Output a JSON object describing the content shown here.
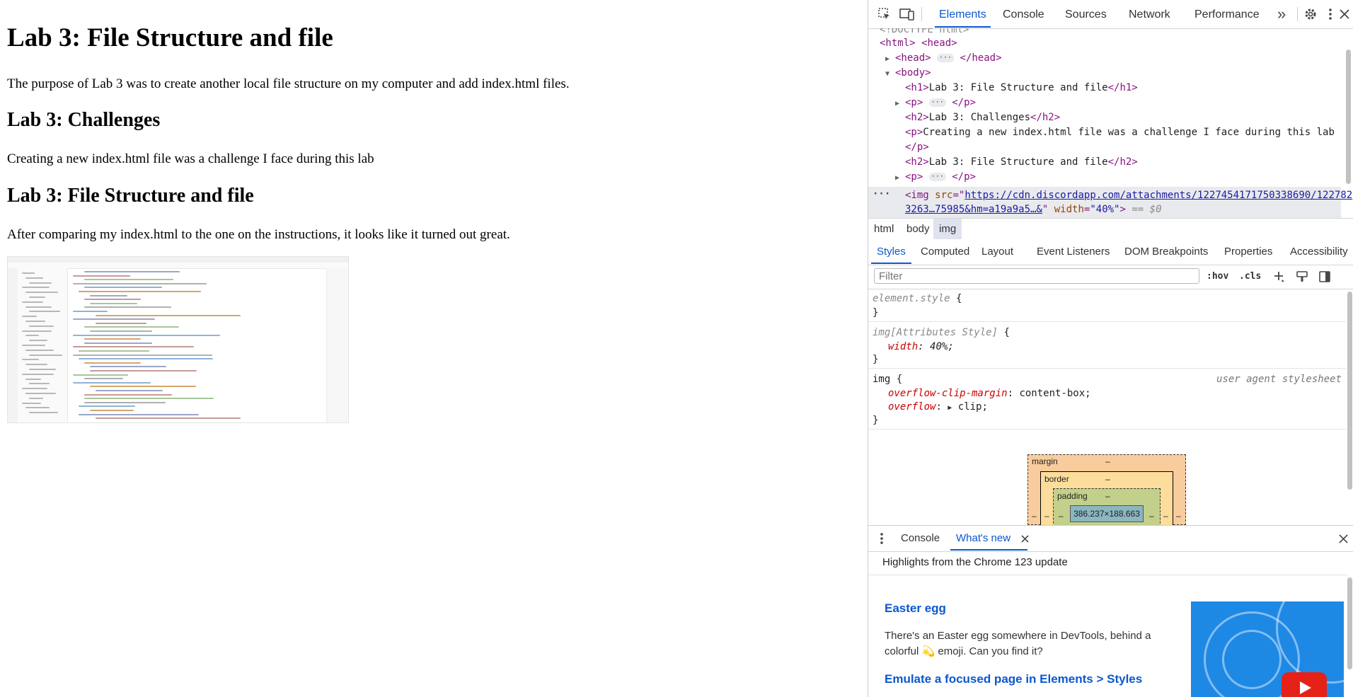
{
  "page": {
    "h1": "Lab 3: File Structure and file",
    "intro": "The purpose of Lab 3 was to create another local file structure on my computer and add index.html files.",
    "h2_challenges": "Lab 3: Challenges",
    "challenge_text": "Creating a new index.html file was a challenge I face during this lab",
    "h2_structure": "Lab 3: File Structure and file",
    "result_text": "After comparing my index.html to the one on the instructions, it looks like it turned out great."
  },
  "devtools": {
    "tabs": [
      "Elements",
      "Console",
      "Sources",
      "Network",
      "Performance"
    ],
    "more_tabs": "»",
    "dom": {
      "doctype": "<!DOCTYPE html>",
      "html_open": "<html>",
      "head_open": "<head>",
      "head_close": "</head>",
      "body_open": "<body>",
      "h1_open": "<h1>",
      "h1_text": "Lab 3: File Structure and file",
      "h1_close": "</h1>",
      "p_open": "<p>",
      "p_close": "</p>",
      "h2_open": "<h2>",
      "h2_close": "</h2>",
      "h2a_text": "Lab 3: Challenges",
      "p2_text": "Creating a new index.html file was a challenge I face during this lab",
      "h2b_text": "Lab 3: File Structure and file",
      "img_tag": "<img",
      "img_attr_src": "src",
      "img_src_line1": "https://cdn.discordapp.com/attachments/1227454171750338690/122782",
      "img_src_line2": "3263…75985&hm=a19a9a5…&",
      "img_attr_width": "width",
      "img_width_val": "\"40%\"",
      "img_end": ">",
      "eq0": "== $0",
      "dots": "···"
    },
    "breadcrumbs": [
      "html",
      "body",
      "img"
    ],
    "subtabs": [
      "Styles",
      "Computed",
      "Layout",
      "Event Listeners",
      "DOM Breakpoints",
      "Properties",
      "Accessibility"
    ],
    "filter": {
      "placeholder": "Filter",
      "hov": ":hov",
      "cls": ".cls"
    },
    "rules": {
      "element_selector": "element.style",
      "attr_selector": "img[Attributes Style]",
      "attr_prop": "width",
      "attr_val": "40%",
      "ua_selector": "img",
      "ua_origin": "user agent stylesheet",
      "ua_prop1": "overflow-clip-margin",
      "ua_val1": "content-box",
      "ua_prop2": "overflow",
      "ua_val2": "clip"
    },
    "box_model": {
      "margin": "margin",
      "border": "border",
      "padding": "padding",
      "dash": "–",
      "content_size": "386.237×188.663"
    },
    "drawer": {
      "tabs": [
        "Console",
        "What's new"
      ],
      "highlights": "Highlights from the Chrome 123 update",
      "item1_title": "Easter egg",
      "item1_body": "There's an Easter egg somewhere in DevTools, behind a colorful 💫 emoji. Can you find it?",
      "item2_title": "Emulate a focused page in Elements > Styles"
    },
    "colors": {
      "accent": "#0b57d0",
      "tag": "#881280",
      "attr": "#994500",
      "value": "#1a1aa6"
    }
  }
}
